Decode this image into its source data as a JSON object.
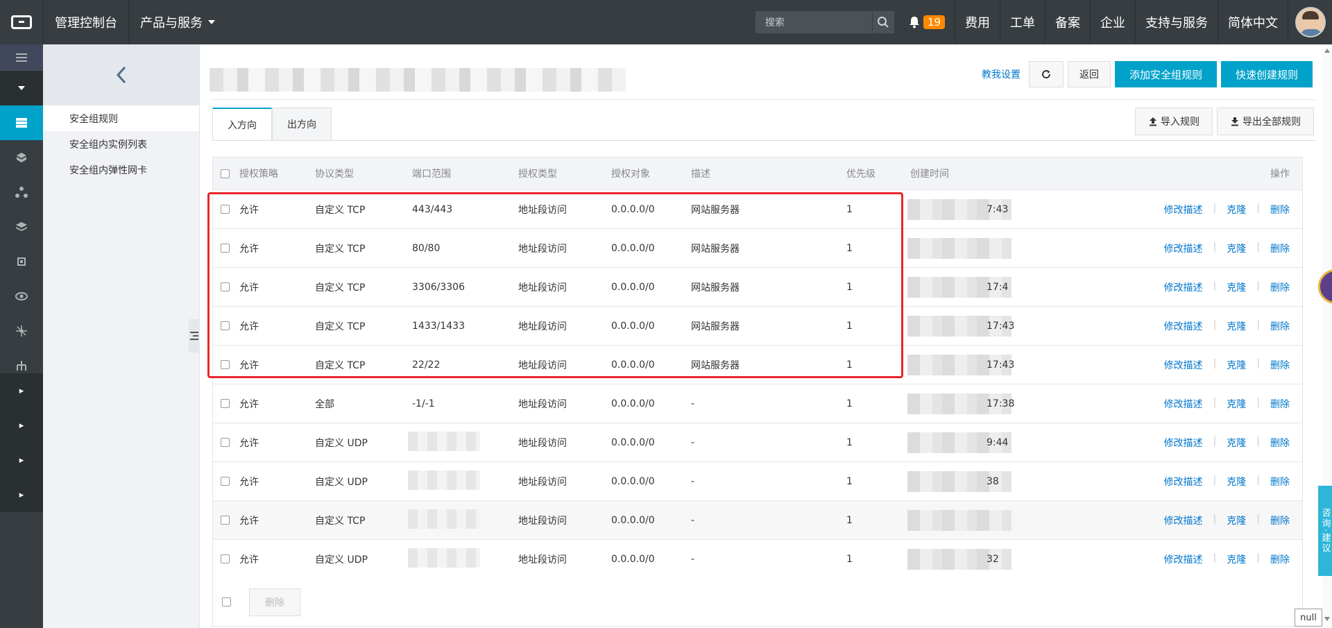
{
  "topbar": {
    "console": "管理控制台",
    "products": "产品与服务",
    "search_placeholder": "搜索",
    "notification_count": "19",
    "nav": [
      "费用",
      "工单",
      "备案",
      "企业",
      "支持与服务",
      "简体中文"
    ]
  },
  "subsidebar": {
    "items": [
      "安全组规则",
      "安全组内实例列表",
      "安全组内弹性网卡"
    ]
  },
  "actions": {
    "help_link": "教我设置",
    "back": "返回",
    "add_rule": "添加安全组规则",
    "quick_create": "快速创建规则"
  },
  "tabs": [
    "入方向",
    "出方向"
  ],
  "tab_actions": {
    "import": "导入规则",
    "export": "导出全部规则"
  },
  "table": {
    "headers": [
      "授权策略",
      "协议类型",
      "端口范围",
      "授权类型",
      "授权对象",
      "描述",
      "优先级",
      "创建时间",
      "操作"
    ],
    "rows": [
      {
        "policy": "允许",
        "protocol": "自定义 TCP",
        "port": "443/443",
        "auth_type": "地址段访问",
        "object": "0.0.0.0/0",
        "desc": "网站服务器",
        "priority": "1",
        "time": "7:43"
      },
      {
        "policy": "允许",
        "protocol": "自定义 TCP",
        "port": "80/80",
        "auth_type": "地址段访问",
        "object": "0.0.0.0/0",
        "desc": "网站服务器",
        "priority": "1",
        "time": ""
      },
      {
        "policy": "允许",
        "protocol": "自定义 TCP",
        "port": "3306/3306",
        "auth_type": "地址段访问",
        "object": "0.0.0.0/0",
        "desc": "网站服务器",
        "priority": "1",
        "time": "17:4"
      },
      {
        "policy": "允许",
        "protocol": "自定义 TCP",
        "port": "1433/1433",
        "auth_type": "地址段访问",
        "object": "0.0.0.0/0",
        "desc": "网站服务器",
        "priority": "1",
        "time": "17:43"
      },
      {
        "policy": "允许",
        "protocol": "自定义 TCP",
        "port": "22/22",
        "auth_type": "地址段访问",
        "object": "0.0.0.0/0",
        "desc": "网站服务器",
        "priority": "1",
        "time": "17:43"
      },
      {
        "policy": "允许",
        "protocol": "全部",
        "port": "-1/-1",
        "auth_type": "地址段访问",
        "object": "0.0.0.0/0",
        "desc": "-",
        "priority": "1",
        "time": "17:38"
      },
      {
        "policy": "允许",
        "protocol": "自定义 UDP",
        "port": "",
        "auth_type": "地址段访问",
        "object": "0.0.0.0/0",
        "desc": "-",
        "priority": "1",
        "time": "9:44"
      },
      {
        "policy": "允许",
        "protocol": "自定义 UDP",
        "port": "",
        "auth_type": "地址段访问",
        "object": "0.0.0.0/0",
        "desc": "-",
        "priority": "1",
        "time": "38"
      },
      {
        "policy": "允许",
        "protocol": "自定义 TCP",
        "port": "",
        "auth_type": "地址段访问",
        "object": "0.0.0.0/0",
        "desc": "-",
        "priority": "1",
        "time": ""
      },
      {
        "policy": "允许",
        "protocol": "自定义 UDP",
        "port": "",
        "auth_type": "地址段访问",
        "object": "0.0.0.0/0",
        "desc": "-",
        "priority": "1",
        "time": "32"
      }
    ],
    "ops": [
      "修改描述",
      "克隆",
      "删除"
    ]
  },
  "footer": {
    "delete": "删除"
  },
  "widgets": {
    "consult": "咨询·建议",
    "null_label": "null"
  },
  "colors": {
    "accent": "#00a2ca",
    "topbar": "#373d41",
    "highlight": "#e8262b",
    "link": "#0077cc",
    "badge": "#ff8a00"
  }
}
